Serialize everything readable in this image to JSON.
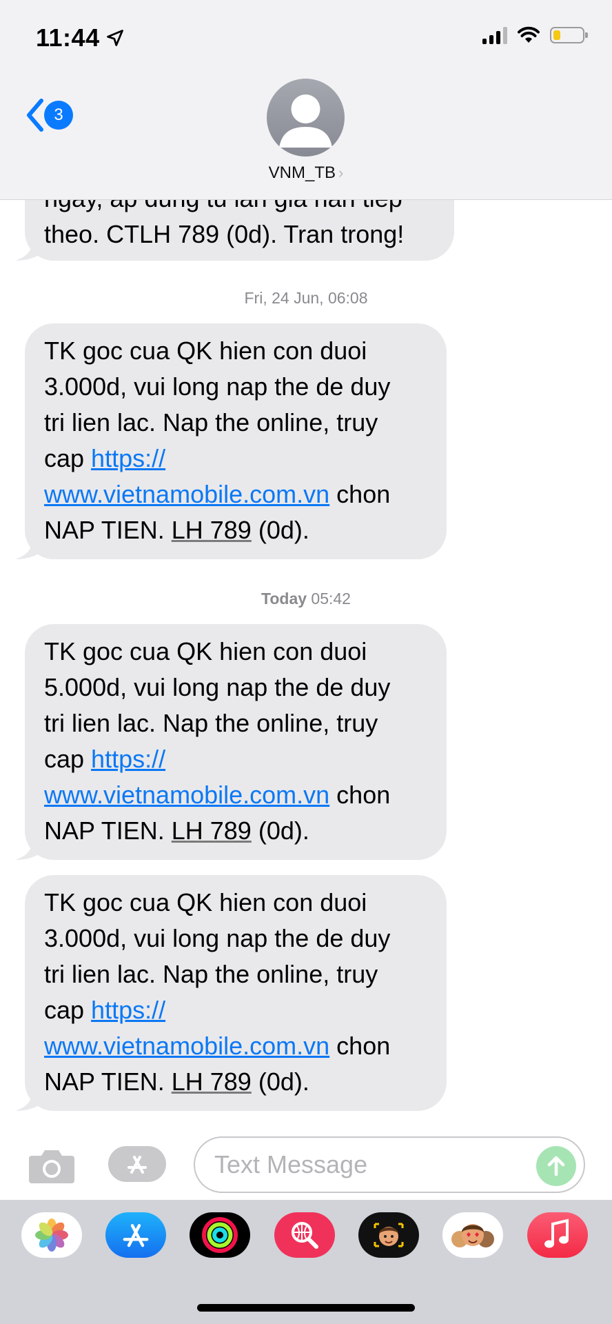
{
  "status": {
    "time": "11:44"
  },
  "header": {
    "back_count": "3",
    "contact_name": "VNM_TB",
    "chevron": "›"
  },
  "messages": {
    "top_partial": {
      "line1": "ngay, ap dung tu lan gia han tiep",
      "line2": "theo. CTLH 789 (0d). Tran trong!"
    },
    "timestamp1": {
      "day": "Fri, 24 Jun,",
      "time": "06:08"
    },
    "timestamp2": {
      "day": "Today",
      "time": "05:42"
    },
    "m1": {
      "l1": "TK goc cua QK hien con duoi",
      "l2": "3.000d, vui long nap the de duy",
      "l3": "tri lien lac. Nap the online, truy",
      "l4a": "cap ",
      "link_a": "https://",
      "link_b": "www.vietnamobile.com.vn",
      "l5b": " chon",
      "l6a": "NAP TIEN. ",
      "lh": "LH 789",
      "l6c": " (0d)."
    },
    "m2": {
      "l1": "TK goc cua QK hien con duoi",
      "l2": "5.000d, vui long nap the de duy",
      "l3": "tri lien lac. Nap the online, truy",
      "l4a": "cap ",
      "link_a": "https://",
      "link_b": "www.vietnamobile.com.vn",
      "l5b": " chon",
      "l6a": "NAP TIEN. ",
      "lh": "LH 789",
      "l6c": " (0d)."
    },
    "m3": {
      "l1": "TK goc cua QK hien con duoi",
      "l2": "3.000d, vui long nap the de duy",
      "l3": "tri lien lac. Nap the online, truy",
      "l4a": "cap ",
      "link_a": "https://",
      "link_b": "www.vietnamobile.com.vn",
      "l5b": " chon",
      "l6a": "NAP TIEN. ",
      "lh": "LH 789",
      "l6c": " (0d)."
    }
  },
  "input": {
    "placeholder": "Text Message"
  },
  "colors": {
    "accent": "#0a7bfe",
    "bubble": "#e9e9eb",
    "link": "#0b78f5",
    "send": "#a7e4b4"
  },
  "drawer_apps": [
    "photos-icon",
    "app-store-icon",
    "activity-icon",
    "web-search-icon",
    "memoji-icon",
    "memoji-stickers-icon",
    "music-icon"
  ]
}
